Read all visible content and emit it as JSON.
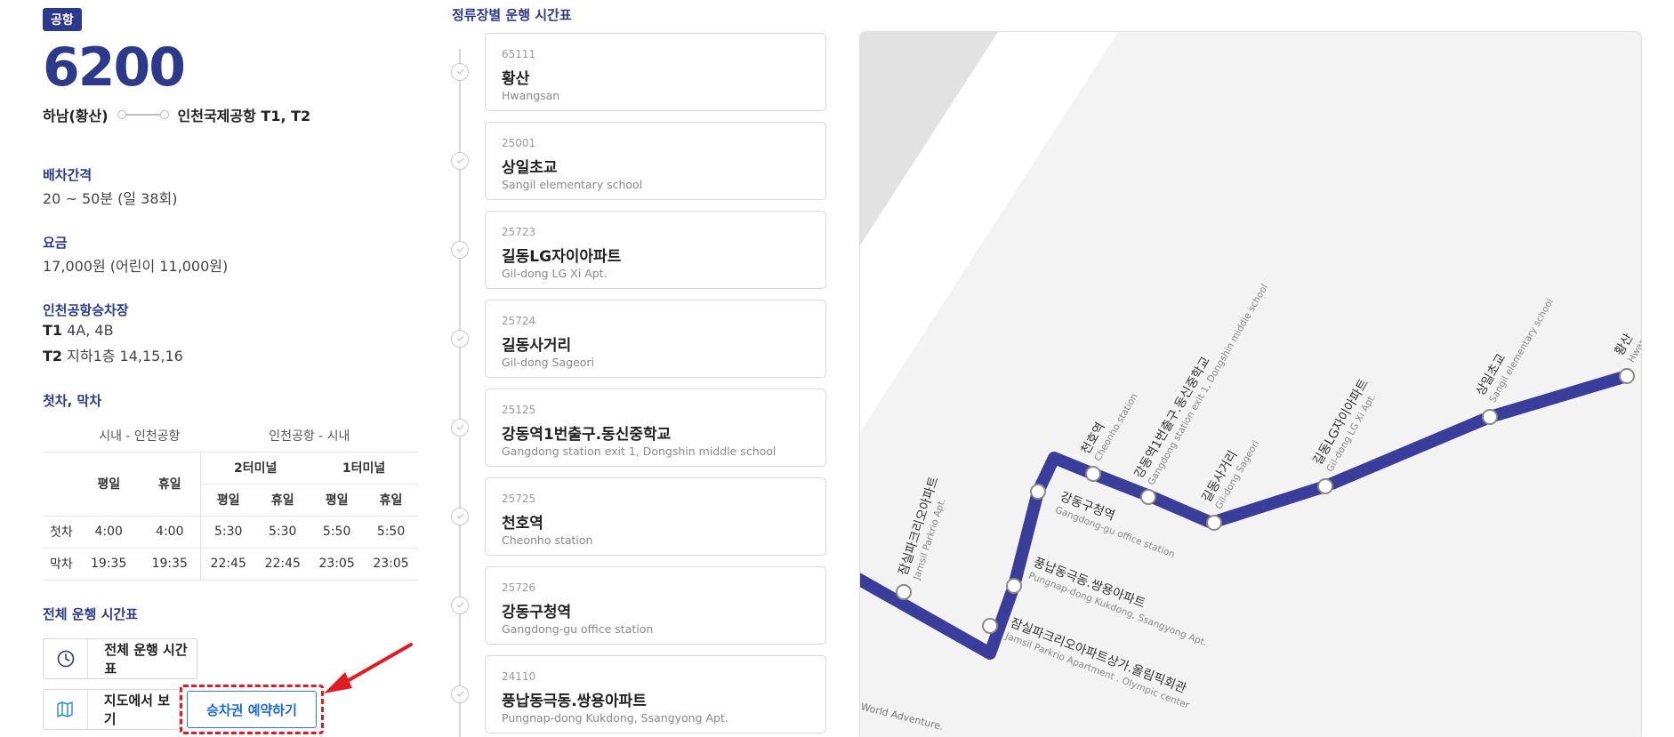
{
  "route": {
    "badge": "공항",
    "number": "6200",
    "origin": "하남(황산)",
    "destination": "인천국제공항 T1, T2"
  },
  "info": {
    "interval_title": "배차간격",
    "interval_value": "20 ~ 50분 (일 38회)",
    "fare_title": "요금",
    "fare_value": "17,000원 (어린이 11,000원)",
    "boarding_title": "인천공항승차장",
    "t1_label": "T1",
    "t1_value": " 4A, 4B",
    "t2_label": "T2",
    "t2_value": " 지하1층 14,15,16",
    "firstlast_title": "첫차, 막차"
  },
  "timetable": {
    "group_city": "시내 - 인천공항",
    "group_airport": "인천공항 - 시내",
    "weekday": "평일",
    "holiday": "휴일",
    "terminal2": "2터미널",
    "terminal1": "1터미널",
    "rows": [
      {
        "label": "첫차",
        "c": [
          "4:00",
          "4:00",
          "5:30",
          "5:30",
          "5:50",
          "5:50"
        ]
      },
      {
        "label": "막차",
        "c": [
          "19:35",
          "19:35",
          "22:45",
          "22:45",
          "23:05",
          "23:05"
        ]
      }
    ]
  },
  "full_timetable": {
    "title": "전체 운행 시간표",
    "button_label": "전체 운행 시간표",
    "map_button_label": "지도에서 보기",
    "reserve_button_label": "승차권 예약하기"
  },
  "stops_title": "정류장별 운행 시간표",
  "stops": [
    {
      "code": "65111",
      "name": "황산",
      "en": "Hwangsan"
    },
    {
      "code": "25001",
      "name": "상일초교",
      "en": "Sangil elementary school"
    },
    {
      "code": "25723",
      "name": "길동LG자이아파트",
      "en": "Gil-dong LG Xi Apt."
    },
    {
      "code": "25724",
      "name": "길동사거리",
      "en": "Gil-dong Sageori"
    },
    {
      "code": "25125",
      "name": "강동역1번출구.동신중학교",
      "en": "Gangdong station exit 1, Dongshin middle school"
    },
    {
      "code": "25725",
      "name": "천호역",
      "en": "Cheonho station"
    },
    {
      "code": "25726",
      "name": "강동구청역",
      "en": "Gangdong-gu office station"
    },
    {
      "code": "24110",
      "name": "풍납동극동.쌍용아파트",
      "en": "Pungnap-dong Kukdong, Ssangyong Apt."
    }
  ],
  "map": {
    "route_color": "#3a3d99",
    "labels": [
      {
        "ko": "황산",
        "en": "Hwangsan"
      },
      {
        "ko": "상일초교",
        "en": "Sangil elementary school"
      },
      {
        "ko": "길동LG자이아파트",
        "en": "Gil-dong LG Xi Apt."
      },
      {
        "ko": "길동사거리",
        "en": "Gil-dong Sageori"
      },
      {
        "ko": "강동역1번출구.동신중학교",
        "en": "Gangdong station exit 1, Dongshin middle school"
      },
      {
        "ko": "천호역",
        "en": "Cheonho station"
      },
      {
        "ko": "강동구청역",
        "en": "Gangdong-gu office station"
      },
      {
        "ko": "풍납동극동.쌍용아파트",
        "en": "Pungnap-dong Kukdong, Ssangyong Apt."
      },
      {
        "ko": "잠실파크리오아파트상가.올림픽회관",
        "en": "Jamsil Parkrio Apartment . Olympic center"
      },
      {
        "ko": "잠실파크리오아파트",
        "en": "Jamsil Parkrio Apt."
      }
    ],
    "corner_text": "World Adventure."
  }
}
